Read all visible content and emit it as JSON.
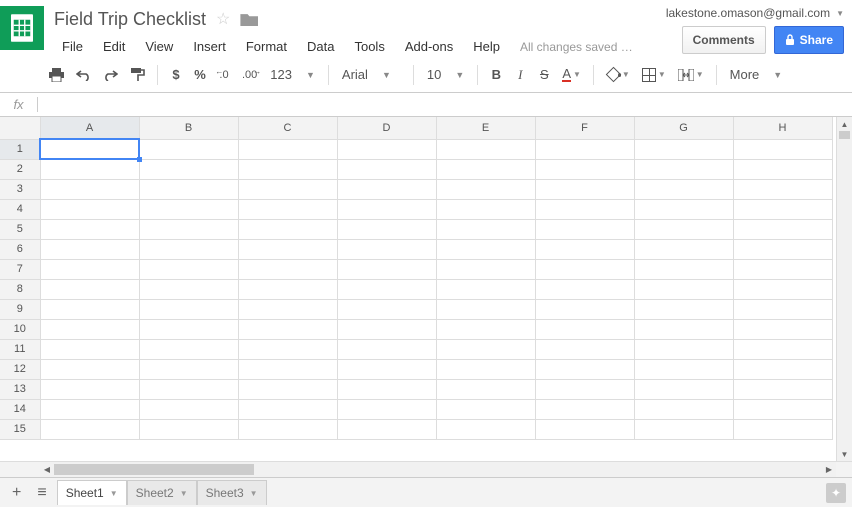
{
  "header": {
    "doc_title": "Field Trip Checklist",
    "user_email": "lakestone.omason@gmail.com",
    "comments_label": "Comments",
    "share_label": "Share",
    "save_status": "All changes saved …"
  },
  "menubar": [
    "File",
    "Edit",
    "View",
    "Insert",
    "Format",
    "Data",
    "Tools",
    "Add-ons",
    "Help"
  ],
  "toolbar": {
    "currency": "$",
    "percent": "%",
    "dec_dec": ".0",
    "inc_dec": ".00",
    "more_formats": "123",
    "font": "Arial",
    "font_size": "10",
    "bold": "B",
    "italic": "I",
    "strike": "S",
    "text_color": "A",
    "more": "More"
  },
  "fx": {
    "label": "fx",
    "value": ""
  },
  "grid": {
    "columns": [
      "A",
      "B",
      "C",
      "D",
      "E",
      "F",
      "G",
      "H"
    ],
    "row_count": 15,
    "selected_cell": "A1"
  },
  "tabs": {
    "sheets": [
      "Sheet1",
      "Sheet2",
      "Sheet3"
    ],
    "active": 0
  }
}
